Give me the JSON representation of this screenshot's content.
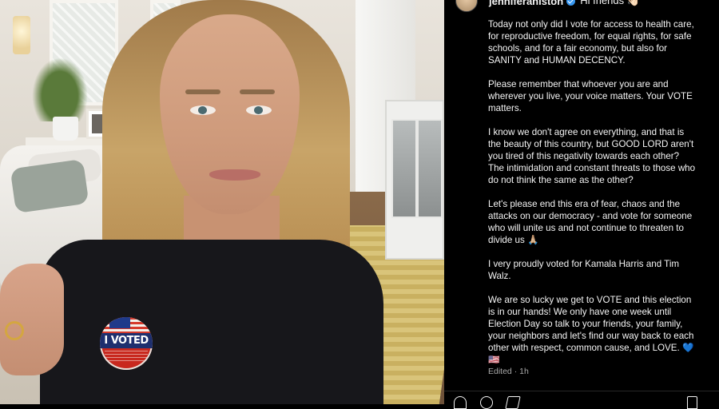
{
  "post": {
    "username": "jenniferaniston",
    "greeting": "Hi friends 👋🏻",
    "verified": true,
    "sticker_text": "I VOTED",
    "caption": [
      "Today not only did I vote for access to health care, for reproductive freedom, for equal rights, for safe schools, and for a fair economy, but also for SANITY and HUMAN DECENCY.",
      "Please remember that whoever you are and wherever you live, your voice matters. Your VOTE matters.",
      "I know we don't agree on everything, and that is the beauty of this country, but GOOD LORD aren't you tired of this negativity towards each other? The intimidation and constant threats to those who do not think the same as the other?",
      "Let's please end this era of fear, chaos and the attacks on our democracy - and vote for someone who will unite us and not continue to threaten to divide us 🙏🏼",
      "I very proudly voted for Kamala Harris and Tim Walz.",
      "We are so lucky we get to VOTE and this election is in our hands! We only have one week until Election Day so talk to your friends, your family, your neighbors and let's find our way back to each other with respect, common cause, and LOVE. 💙 🇺🇸"
    ],
    "edited_label": "Edited · 1h"
  },
  "icons": {
    "verified": "verified-badge-icon",
    "like": "heart-icon",
    "comment": "comment-icon",
    "share": "share-icon",
    "save": "bookmark-icon"
  },
  "colors": {
    "background": "#000000",
    "text": "#f5f5f5",
    "muted": "#a8a8a8",
    "verified_blue": "#3797f0"
  }
}
